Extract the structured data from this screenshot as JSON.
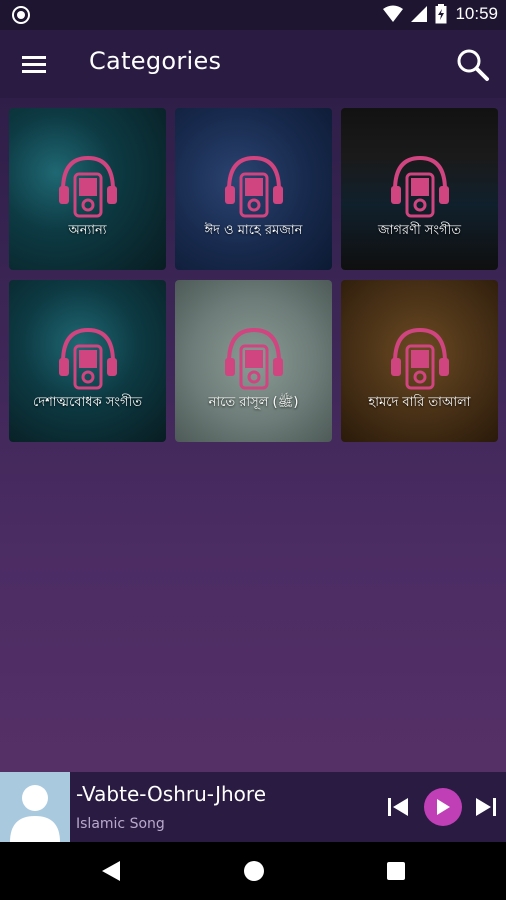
{
  "status_bar": {
    "time": "10:59",
    "icons": [
      "notification-dot-icon",
      "wifi-icon",
      "signal-icon",
      "battery-icon"
    ]
  },
  "toolbar": {
    "title": "Categories",
    "menu_icon": "hamburger-menu-icon",
    "search_icon": "search-icon"
  },
  "categories": [
    {
      "label": "অন্যান্য",
      "bg": "#0d2b33"
    },
    {
      "label": "ঈদ ও মাহে রমজান",
      "bg": "#15274a"
    },
    {
      "label": "জাগরণী সংগীত",
      "bg": "#141414"
    },
    {
      "label": "দেশাত্মবোধক সংগীত",
      "bg": "#0c2a33"
    },
    {
      "label": "নাতে রাসূল (ﷺ)",
      "bg": "#6a7a76"
    },
    {
      "label": "হামদে বারি তাআলা",
      "bg": "#3a2712"
    }
  ],
  "player": {
    "title": "-Vabte-Oshru-Jhore",
    "subtitle": "Islamic Song",
    "controls": [
      "skip-previous-icon",
      "play-icon",
      "skip-next-icon"
    ],
    "accent": "#c03fb6"
  },
  "nav_bar": [
    "back-icon",
    "home-icon",
    "recent-apps-icon"
  ]
}
